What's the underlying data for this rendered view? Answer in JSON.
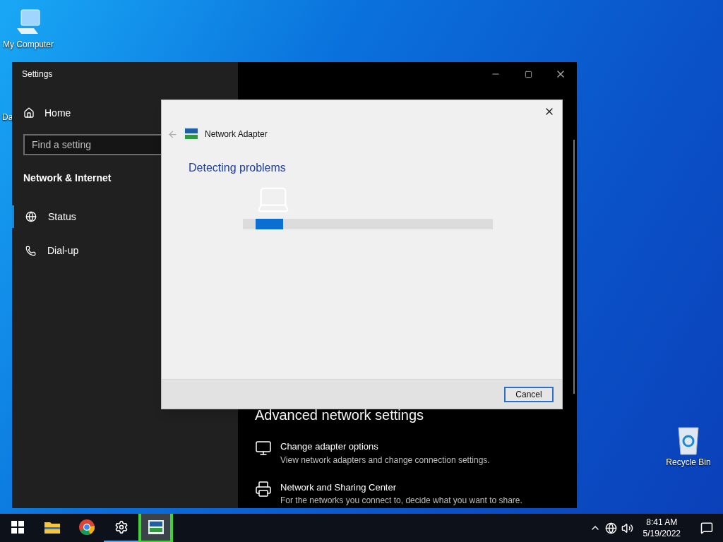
{
  "desktop": {
    "icons": [
      {
        "kind": "computer",
        "label": "My Computer"
      },
      {
        "kind": "partial",
        "label": "Da"
      },
      {
        "kind": "recycle",
        "label": "Recycle Bin"
      }
    ]
  },
  "settings_window": {
    "title": "Settings",
    "home": "Home",
    "search": {
      "placeholder": "Find a setting"
    },
    "section": "Network & Internet",
    "nav_items": [
      {
        "kind": "status",
        "label": "Status",
        "selected": true
      },
      {
        "kind": "dialup",
        "label": "Dial-up",
        "selected": false
      }
    ],
    "content": {
      "heading": "Advanced network settings",
      "links": [
        {
          "kind": "adapter",
          "title": "Change adapter options",
          "description": "View network adapters and change connection settings."
        },
        {
          "kind": "sharing",
          "title": "Network and Sharing Center",
          "description": "For the networks you connect to, decide what you want to share."
        }
      ]
    }
  },
  "dialog": {
    "title": "Network Adapter",
    "heading": "Detecting problems",
    "progress": {
      "level": 0.11
    },
    "buttons": [
      "Cancel"
    ]
  },
  "taskbar": {
    "apps": [
      {
        "kind": "start",
        "running": false,
        "selected": false
      },
      {
        "kind": "explorer",
        "running": false,
        "selected": false
      },
      {
        "kind": "chrome",
        "running": false,
        "selected": false
      },
      {
        "kind": "settings",
        "running": true,
        "selected": false
      },
      {
        "kind": "adapter",
        "running": true,
        "selected": true
      }
    ],
    "clock": {
      "time": "8:41 AM",
      "date": "5/19/2022"
    }
  }
}
